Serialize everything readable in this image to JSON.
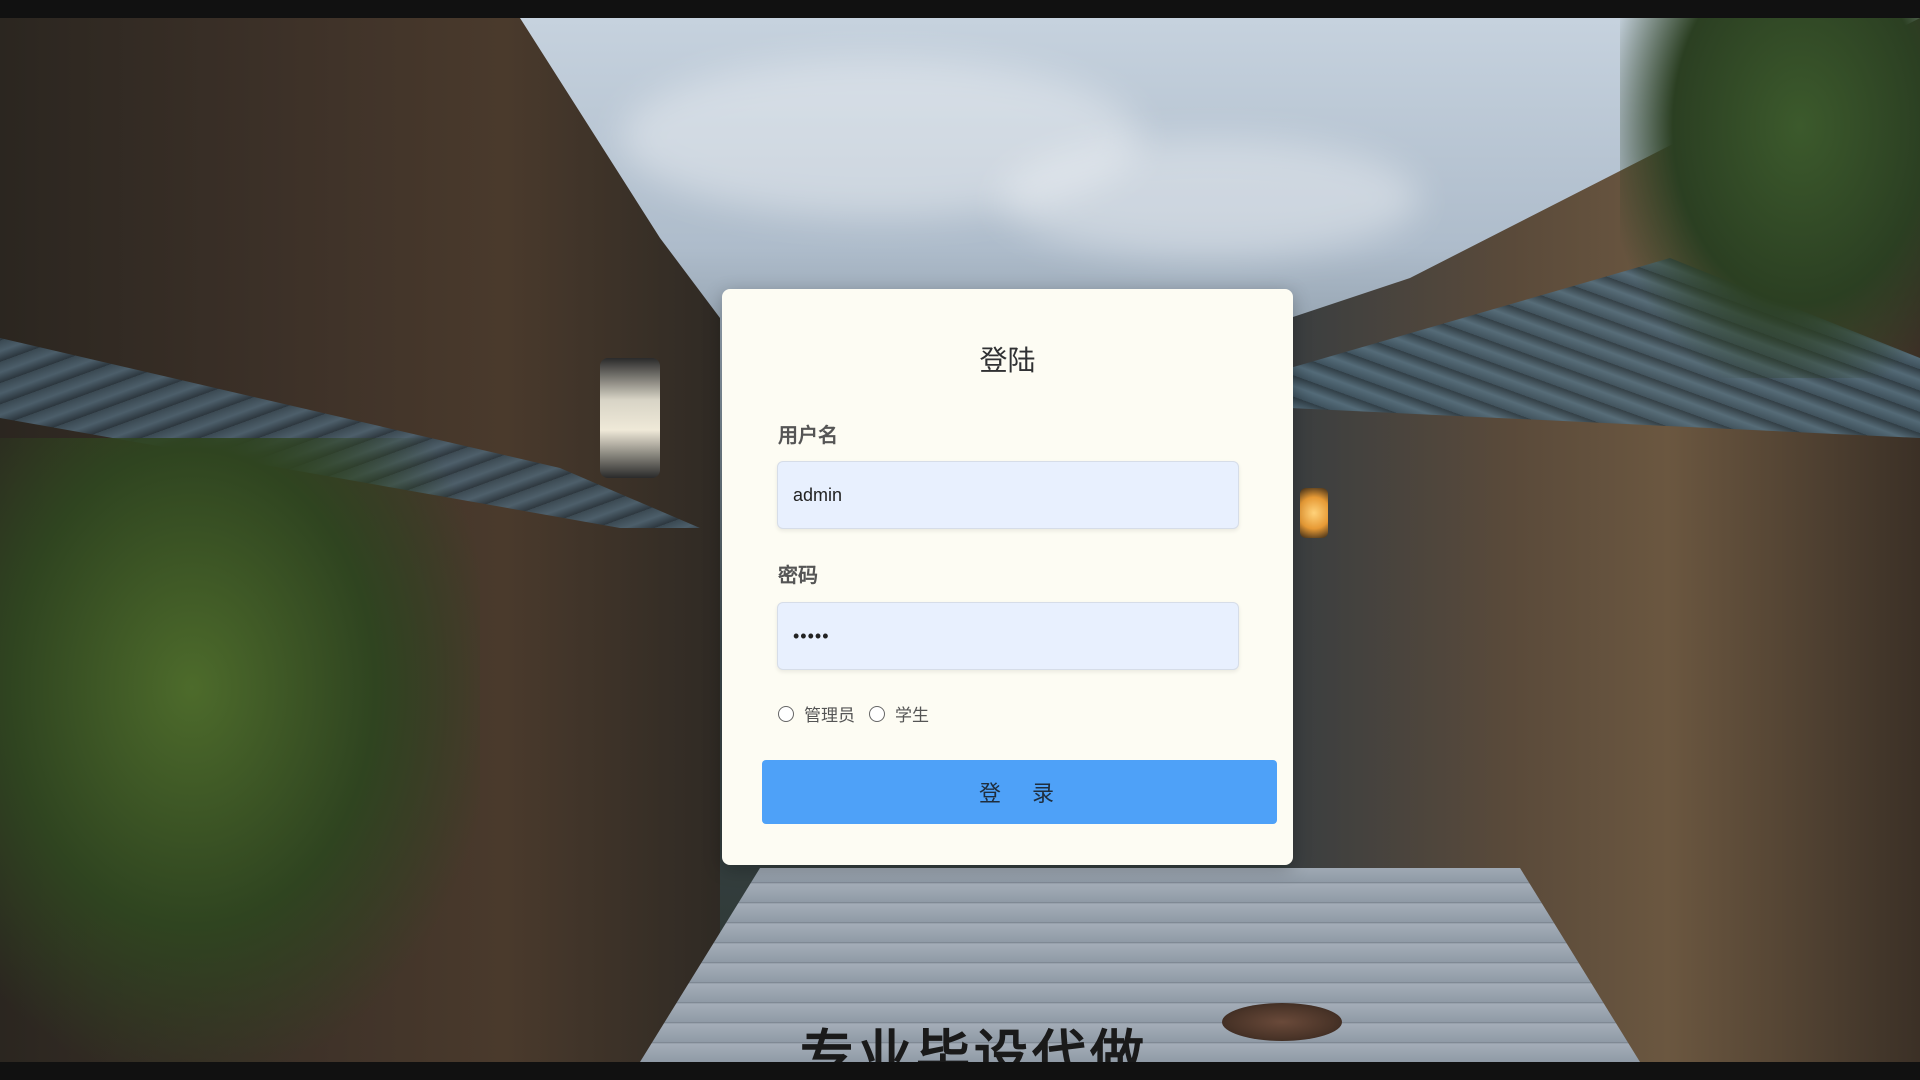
{
  "login": {
    "title": "登陆",
    "username_label": "用户名",
    "username_value": "admin",
    "password_label": "密码",
    "password_value": "•••••",
    "roles": [
      {
        "label": "管理员",
        "selected": false
      },
      {
        "label": "学生",
        "selected": false
      }
    ],
    "submit_label": "登 录",
    "colors": {
      "card_background": "#fdfcf3",
      "input_background": "#e8f0fe",
      "button_background": "#4ea1f8"
    }
  },
  "background": {
    "caption_fragment": "专业毕设代做"
  }
}
